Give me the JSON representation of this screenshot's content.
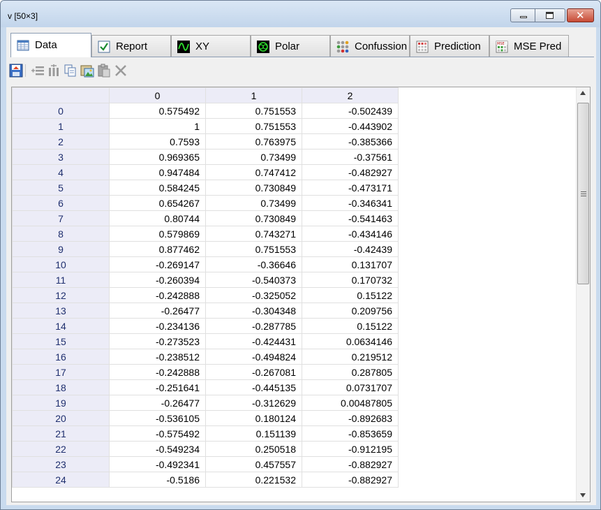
{
  "window": {
    "title": "v [50×3]"
  },
  "tabs": [
    {
      "label": "Data",
      "icon": "table-grid-icon"
    },
    {
      "label": "Report",
      "icon": "check-report-icon"
    },
    {
      "label": "XY",
      "icon": "xy-wave-icon"
    },
    {
      "label": "Polar",
      "icon": "polar-plot-icon"
    },
    {
      "label": "Confussion",
      "icon": "confusion-dots-icon"
    },
    {
      "label": "Prediction",
      "icon": "prediction-grid-icon"
    },
    {
      "label": "MSE Pred",
      "icon": "mse-pred-icon"
    }
  ],
  "toolbar": [
    "save-icon",
    "insert-row-icon",
    "insert-column-icon",
    "copy-icon",
    "paste-image-icon",
    "paste-icon",
    "delete-icon"
  ],
  "table": {
    "columns": [
      "0",
      "1",
      "2"
    ],
    "rows": [
      {
        "index": "0",
        "values": [
          "0.575492",
          "0.751553",
          "-0.502439"
        ]
      },
      {
        "index": "1",
        "values": [
          "1",
          "0.751553",
          "-0.443902"
        ]
      },
      {
        "index": "2",
        "values": [
          "0.7593",
          "0.763975",
          "-0.385366"
        ]
      },
      {
        "index": "3",
        "values": [
          "0.969365",
          "0.73499",
          "-0.37561"
        ]
      },
      {
        "index": "4",
        "values": [
          "0.947484",
          "0.747412",
          "-0.482927"
        ]
      },
      {
        "index": "5",
        "values": [
          "0.584245",
          "0.730849",
          "-0.473171"
        ]
      },
      {
        "index": "6",
        "values": [
          "0.654267",
          "0.73499",
          "-0.346341"
        ]
      },
      {
        "index": "7",
        "values": [
          "0.80744",
          "0.730849",
          "-0.541463"
        ]
      },
      {
        "index": "8",
        "values": [
          "0.579869",
          "0.743271",
          "-0.434146"
        ]
      },
      {
        "index": "9",
        "values": [
          "0.877462",
          "0.751553",
          "-0.42439"
        ]
      },
      {
        "index": "10",
        "values": [
          "-0.269147",
          "-0.36646",
          "0.131707"
        ]
      },
      {
        "index": "11",
        "values": [
          "-0.260394",
          "-0.540373",
          "0.170732"
        ]
      },
      {
        "index": "12",
        "values": [
          "-0.242888",
          "-0.325052",
          "0.15122"
        ]
      },
      {
        "index": "13",
        "values": [
          "-0.26477",
          "-0.304348",
          "0.209756"
        ]
      },
      {
        "index": "14",
        "values": [
          "-0.234136",
          "-0.287785",
          "0.15122"
        ]
      },
      {
        "index": "15",
        "values": [
          "-0.273523",
          "-0.424431",
          "0.0634146"
        ]
      },
      {
        "index": "16",
        "values": [
          "-0.238512",
          "-0.494824",
          "0.219512"
        ]
      },
      {
        "index": "17",
        "values": [
          "-0.242888",
          "-0.267081",
          "0.287805"
        ]
      },
      {
        "index": "18",
        "values": [
          "-0.251641",
          "-0.445135",
          "0.0731707"
        ]
      },
      {
        "index": "19",
        "values": [
          "-0.26477",
          "-0.312629",
          "0.00487805"
        ]
      },
      {
        "index": "20",
        "values": [
          "-0.536105",
          "0.180124",
          "-0.892683"
        ]
      },
      {
        "index": "21",
        "values": [
          "-0.575492",
          "0.151139",
          "-0.853659"
        ]
      },
      {
        "index": "22",
        "values": [
          "-0.549234",
          "0.250518",
          "-0.912195"
        ]
      },
      {
        "index": "23",
        "values": [
          "-0.492341",
          "0.457557",
          "-0.882927"
        ]
      },
      {
        "index": "24",
        "values": [
          "-0.5186",
          "0.221532",
          "-0.882927"
        ]
      }
    ]
  }
}
